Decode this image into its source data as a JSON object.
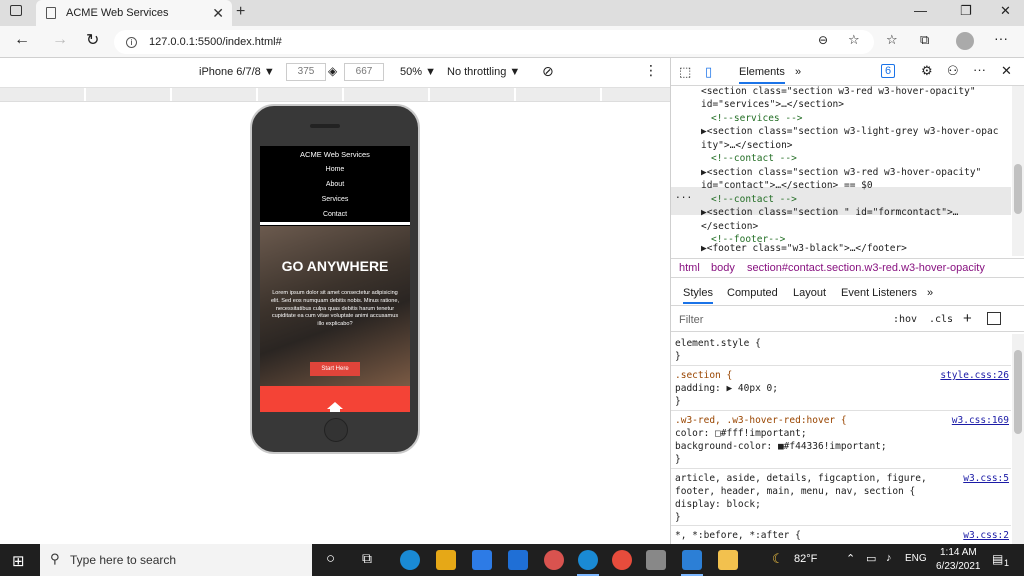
{
  "browser": {
    "tab_title": "ACME Web Services",
    "new_tab": "+",
    "url": "127.0.0.1:5500/index.html#"
  },
  "device_toolbar": {
    "device": "iPhone 6/7/8 ▼",
    "width": "375",
    "height": "667",
    "zoom": "50% ▼",
    "throttle": "No throttling ▼"
  },
  "site": {
    "nav": [
      "ACME Web Services",
      "Home",
      "About",
      "Services",
      "Contact"
    ],
    "hero_title": "GO ANYWHERE",
    "hero_text": "Lorem ipsum dolor sit amet consectetur adipisicing elit. Sed eos numquam debitis nobis. Minus ratione, necessitatibus culpa quas debitis harum tenetur cupiditate ea cum vitae voluptate animi accusamus illo explicabo?",
    "hero_button": "Start Here"
  },
  "devtools": {
    "tab_elements": "Elements",
    "more_tabs": "»",
    "issues_count": "6",
    "code_lines": [
      {
        "indent": 2,
        "text": "<section class=\"section w3-red w3-hover-opacity\""
      },
      {
        "indent": 1,
        "text": "id=\"services\">…</section>"
      },
      {
        "indent": 2,
        "text": "<!--services -->"
      },
      {
        "indent": 1,
        "text": "▶<section class=\"section w3-light-grey w3-hover-opac"
      },
      {
        "indent": 1,
        "text": "ity\">…</section>"
      },
      {
        "indent": 2,
        "text": "<!--contact -->"
      },
      {
        "indent": 1,
        "text": "▶<section class=\"section w3-red w3-hover-opacity\""
      },
      {
        "indent": 1,
        "text": "id=\"contact\">…</section> == $0"
      },
      {
        "indent": 2,
        "text": "<!--contact -->"
      },
      {
        "indent": 1,
        "text": "▶<section class=\"section \" id=\"formcontact\">…"
      },
      {
        "indent": 1,
        "text": "</section>"
      },
      {
        "indent": 2,
        "text": "<!--footer-->"
      },
      {
        "indent": 1,
        "text": "▶<footer class=\"w3-black\">…</footer>"
      }
    ],
    "crumbs": [
      "html",
      "body",
      "section#contact.section.w3-red.w3-hover-opacity"
    ],
    "subtabs": [
      "Styles",
      "Computed",
      "Layout",
      "Event Listeners",
      "»"
    ],
    "filter_placeholder": "Filter",
    "hov": ":hov",
    "cls": ".cls",
    "rules": [
      {
        "text": "element.style {",
        "src": ""
      },
      {
        "text": "}",
        "src": ""
      },
      {
        "text": ".section {",
        "src": "style.css:26"
      },
      {
        "text": "  padding: ▶ 40px 0;",
        "src": ""
      },
      {
        "text": "}",
        "src": ""
      },
      {
        "text": ".w3-red, .w3-hover-red:hover {",
        "src": "w3.css:169"
      },
      {
        "text": "  color: □#fff!important;",
        "src": ""
      },
      {
        "text": "  background-color: ■#f44336!important;",
        "src": ""
      },
      {
        "text": "}",
        "src": ""
      },
      {
        "text": "article, aside, details, figcaption, figure,",
        "src": "w3.css:5"
      },
      {
        "text": "footer, header, main, menu, nav, section {",
        "src": ""
      },
      {
        "text": "  display: block;",
        "src": ""
      },
      {
        "text": "}",
        "src": ""
      },
      {
        "text": "*, *:before, *:after {",
        "src": "w3.css:2"
      }
    ]
  },
  "taskbar": {
    "search_placeholder": "Type here to search",
    "weather": "82°F",
    "lang": "ENG",
    "time": "1:14 AM",
    "date": "6/23/2021",
    "notif": "1"
  },
  "colors": {
    "accent_red": "#f44336",
    "selected_row": "#e8e8e8"
  }
}
